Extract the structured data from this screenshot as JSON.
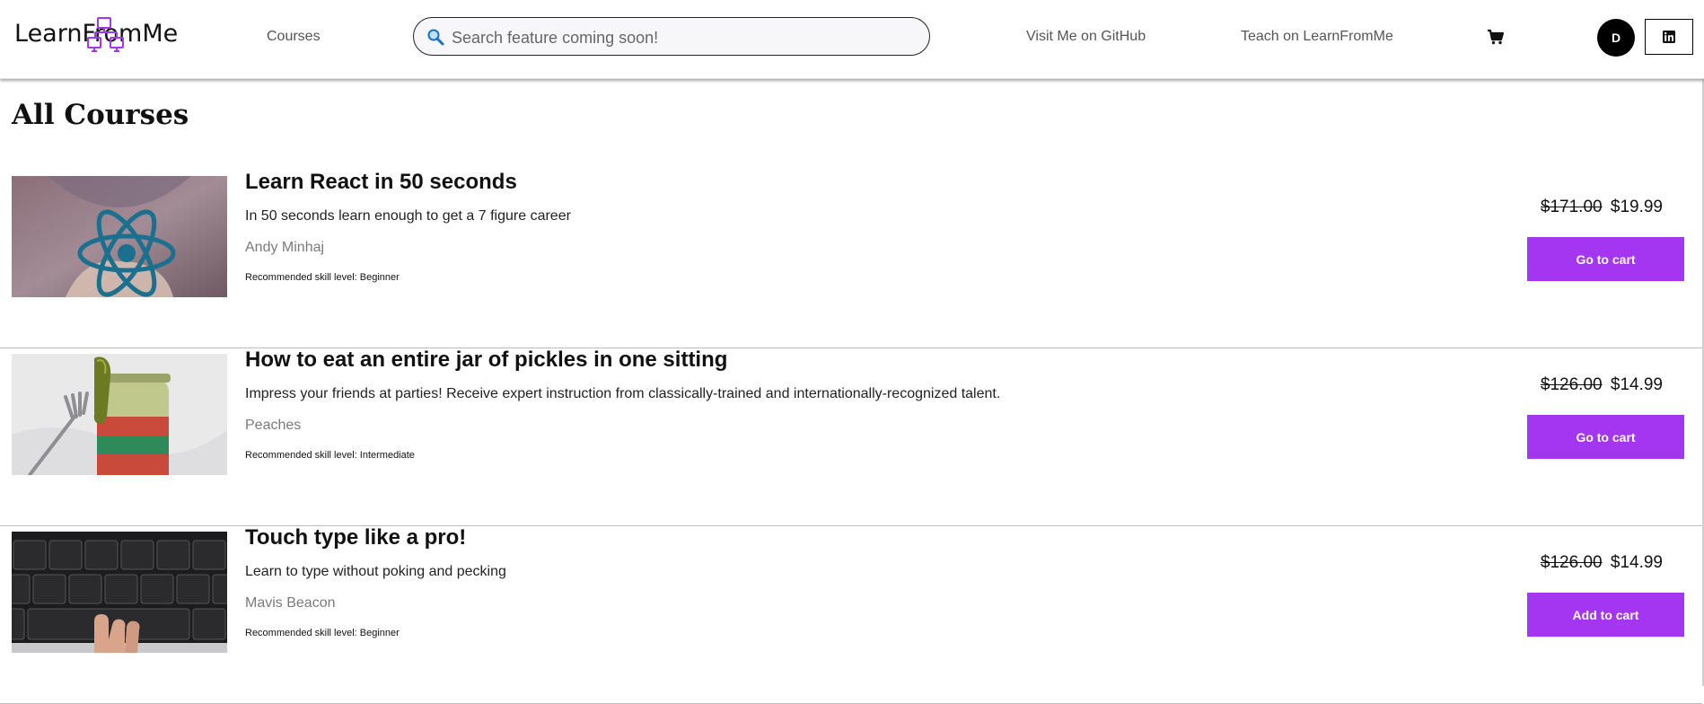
{
  "header": {
    "logo_text": "LearnFromMe",
    "nav_courses": "Courses",
    "search_placeholder": "Search feature coming soon!",
    "nav_github": "Visit Me on GitHub",
    "nav_teach": "Teach on LearnFromMe",
    "avatar_initial": "D"
  },
  "page": {
    "title": "All Courses"
  },
  "colors": {
    "accent": "#a435f0",
    "logo_mark": "#a435f0"
  },
  "icons": {
    "search": "magnifier-icon",
    "cart": "cart-icon",
    "linkedin": "linkedin-icon"
  },
  "courses": [
    {
      "title": "Learn React in 50 seconds",
      "description": "In 50 seconds learn enough to get a 7 figure career",
      "author": "Andy Minhaj",
      "level": "Recommended skill level: Beginner",
      "original_price": "$171.00",
      "price": "$19.99",
      "button": "Go to cart"
    },
    {
      "title": "How to eat an entire jar of pickles in one sitting",
      "description": "Impress your friends at parties! Receive expert instruction from classically-trained and internationally-recognized talent.",
      "author": "Peaches",
      "level": "Recommended skill level: Intermediate",
      "original_price": "$126.00",
      "price": "$14.99",
      "button": "Go to cart"
    },
    {
      "title": "Touch type like a pro!",
      "description": "Learn to type without poking and pecking",
      "author": "Mavis Beacon",
      "level": "Recommended skill level: Beginner",
      "original_price": "$126.00",
      "price": "$14.99",
      "button": "Add to cart"
    }
  ]
}
